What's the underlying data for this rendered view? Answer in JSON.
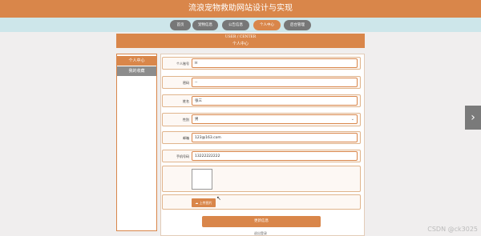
{
  "site": {
    "title": "流浪宠物救助网站设计与实现"
  },
  "nav": {
    "items": [
      {
        "label": "首页"
      },
      {
        "label": "宠物信息"
      },
      {
        "label": "公告信息"
      },
      {
        "label": "个人中心"
      },
      {
        "label": "后台管理"
      }
    ],
    "active": "个人中心"
  },
  "header": {
    "en": "USER / CENTER",
    "cn": "个人中心"
  },
  "sidebar": {
    "items": [
      {
        "label": "个人中心"
      },
      {
        "label": "我的收藏"
      }
    ]
  },
  "form": {
    "fields": [
      {
        "label": "个人账号",
        "value": "H"
      },
      {
        "label": "密码",
        "value": "--"
      },
      {
        "label": "姓名",
        "value": "张三"
      },
      {
        "label": "性别",
        "value": "男"
      },
      {
        "label": "邮箱",
        "value": "123@163.com"
      },
      {
        "label": "手机号码",
        "value": "13222222222"
      }
    ],
    "upload_label": "上传图片",
    "save_label": "更新信息",
    "logout_label": "退出登录"
  },
  "colors": {
    "accent": "#d9864a",
    "nav_bg": "#cde6ea",
    "gray": "#8c8c8c"
  },
  "watermark": "CSDN @ck3025"
}
